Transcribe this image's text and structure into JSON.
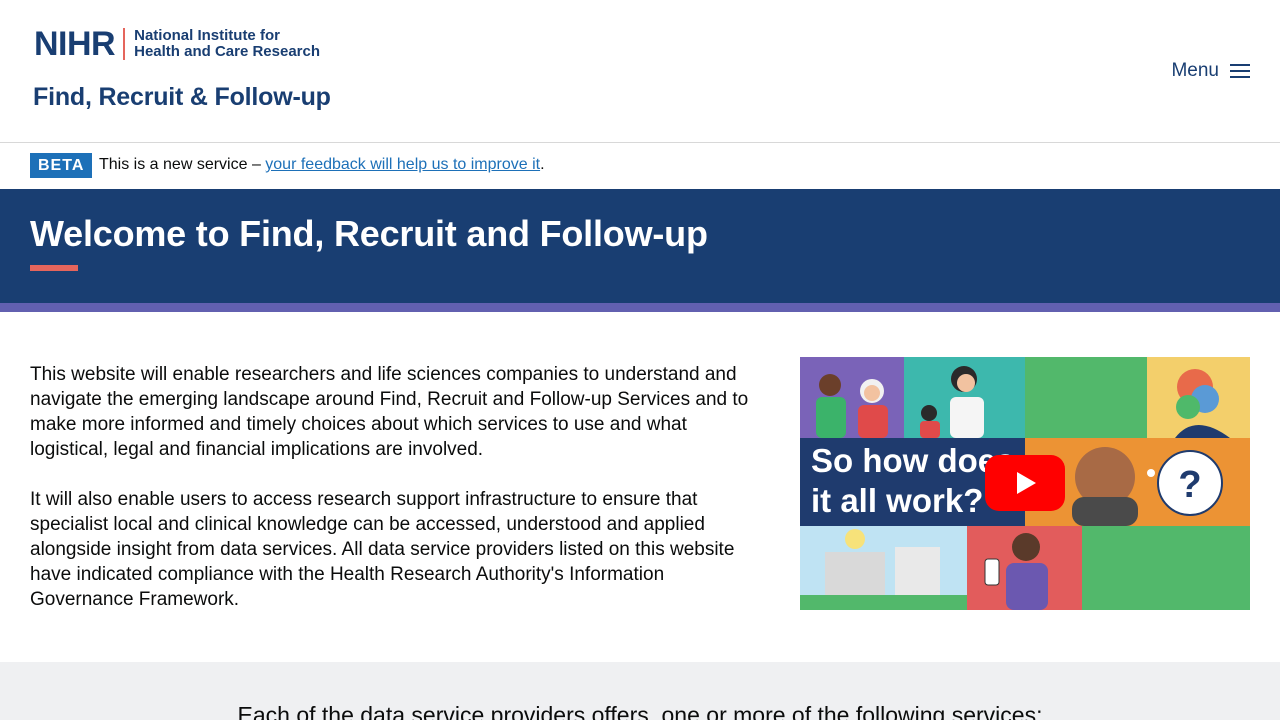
{
  "header": {
    "logo_mark": "NIHR",
    "logo_line1": "National Institute for",
    "logo_line2": "Health and Care Research",
    "service_name": "Find, Recruit & Follow-up",
    "menu_label": "Menu",
    "menu_icon": "hamburger-icon"
  },
  "beta_banner": {
    "tag": "BETA",
    "text_before": "This is a new service – ",
    "link_text": "your feedback will help us to improve it",
    "text_after": "."
  },
  "hero": {
    "title": "Welcome to Find, Recruit and Follow-up"
  },
  "intro": {
    "paragraph1": "This website will enable researchers and life sciences companies to understand and navigate the emerging landscape around Find, Recruit and Follow-up Services and to make more informed and timely choices about which services to use and what logistical, legal and financial implications are involved.",
    "paragraph2": "It will also enable users to access research support infrastructure to ensure that specialist local and clinical knowledge can be accessed, understood and applied alongside insight from data services. All data service providers listed on this website have indicated compliance with the Health Research Authority's Information Governance Framework."
  },
  "video": {
    "caption_line1": "So how does",
    "caption_line2": "it all work?",
    "thought_symbol": "?",
    "play_icon": "play-icon"
  },
  "services_section": {
    "heading": "Each of the data service providers offers, one or more of the following services:"
  },
  "colors": {
    "brand_navy": "#193e72",
    "accent_coral": "#e5655c",
    "stripe_purple": "#6260b0",
    "link_blue": "#1d70b8",
    "youtube_red": "#ff0000"
  }
}
